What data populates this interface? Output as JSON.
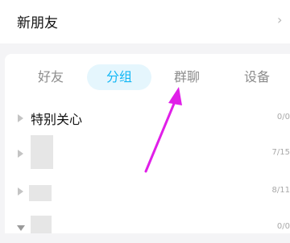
{
  "new_friends": {
    "label": "新朋友",
    "chevron": "›"
  },
  "tabs": [
    {
      "label": "好友",
      "active": false
    },
    {
      "label": "分组",
      "active": true
    },
    {
      "label": "群聊",
      "active": false
    },
    {
      "label": "设备",
      "active": false
    }
  ],
  "groups": [
    {
      "name": "特别关心",
      "count": "0/0",
      "expanded": false
    },
    {
      "name": "",
      "count": "7/15",
      "expanded": false
    },
    {
      "name": "",
      "count": "8/11",
      "expanded": false
    },
    {
      "name": "",
      "count": "0/0",
      "expanded": true
    }
  ],
  "colors": {
    "active_tab_text": "#12b7f5",
    "active_tab_bg": "#e5f6fd",
    "annotation_arrow": "#e01fe8"
  },
  "icons": {
    "expand": "triangle-right-icon",
    "collapse": "triangle-down-icon"
  }
}
